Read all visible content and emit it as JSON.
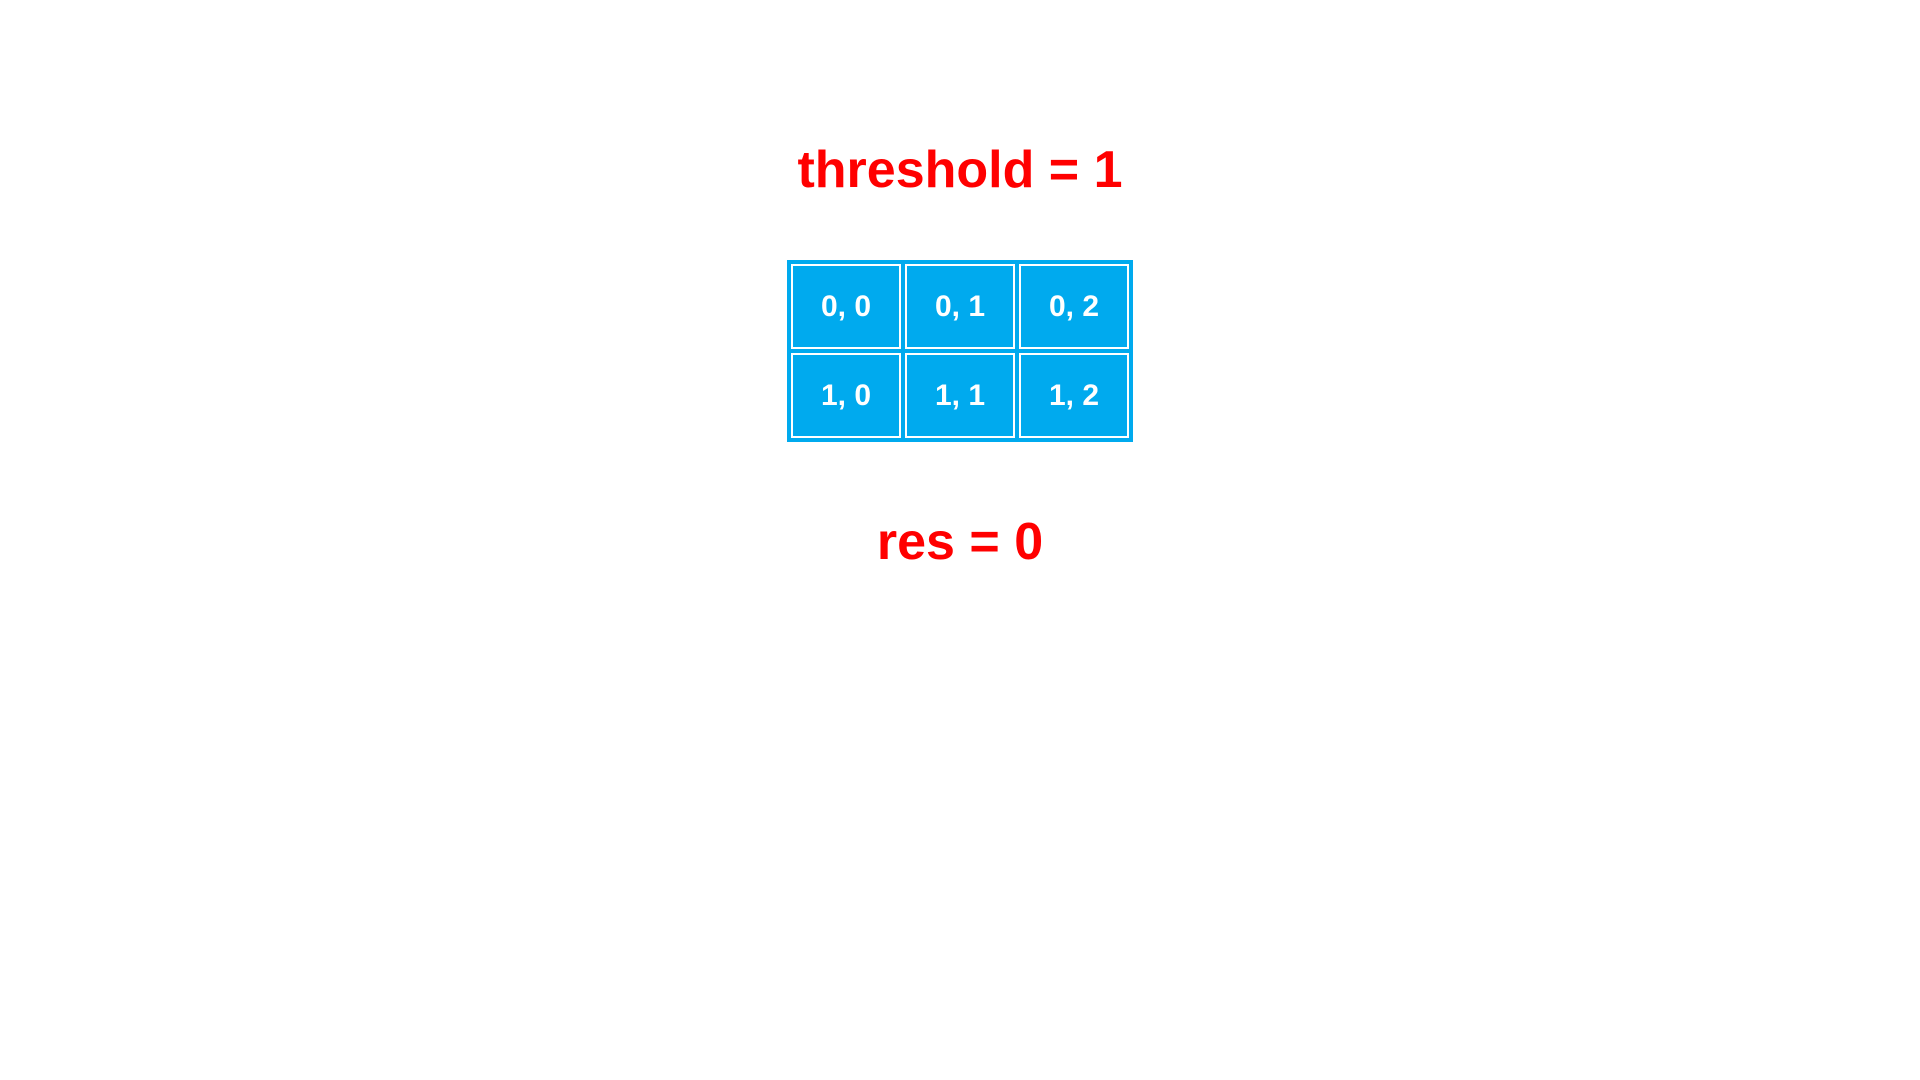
{
  "header": {
    "threshold_label": "threshold = 1"
  },
  "grid": {
    "cells": [
      {
        "row": 0,
        "col": 0,
        "value": "0,  0"
      },
      {
        "row": 0,
        "col": 1,
        "value": "0,  1"
      },
      {
        "row": 0,
        "col": 2,
        "value": "0,  2"
      },
      {
        "row": 1,
        "col": 0,
        "value": "1,  0"
      },
      {
        "row": 1,
        "col": 1,
        "value": "1,  1"
      },
      {
        "row": 1,
        "col": 2,
        "value": "1,  2"
      }
    ],
    "colors": {
      "background": "#00aaee",
      "text": "#ffffff",
      "border": "#ffffff"
    }
  },
  "footer": {
    "res_label": "res = 0"
  }
}
